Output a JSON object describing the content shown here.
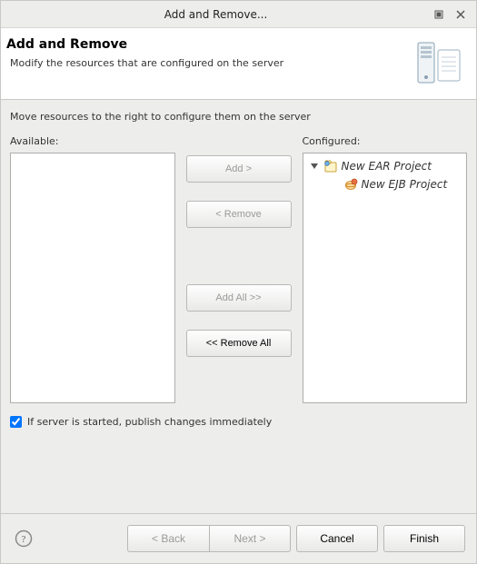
{
  "titlebar": {
    "title": "Add and Remove..."
  },
  "banner": {
    "heading": "Add and Remove",
    "sub": "Modify the resources that are configured on the server"
  },
  "main": {
    "instruction": "Move resources to the right to configure them on the server",
    "available_label": "Available:",
    "configured_label": "Configured:",
    "buttons": {
      "add": "Add >",
      "remove": "< Remove",
      "add_all": "Add All >>",
      "remove_all": "<< Remove All"
    },
    "tree": {
      "root": {
        "label": "New EAR Project"
      },
      "child": {
        "label": "New EJB Project"
      }
    },
    "publish_checkbox": {
      "checked": true,
      "label": "If server is started, publish changes immediately"
    }
  },
  "footer": {
    "back": "< Back",
    "next": "Next >",
    "cancel": "Cancel",
    "finish": "Finish"
  }
}
